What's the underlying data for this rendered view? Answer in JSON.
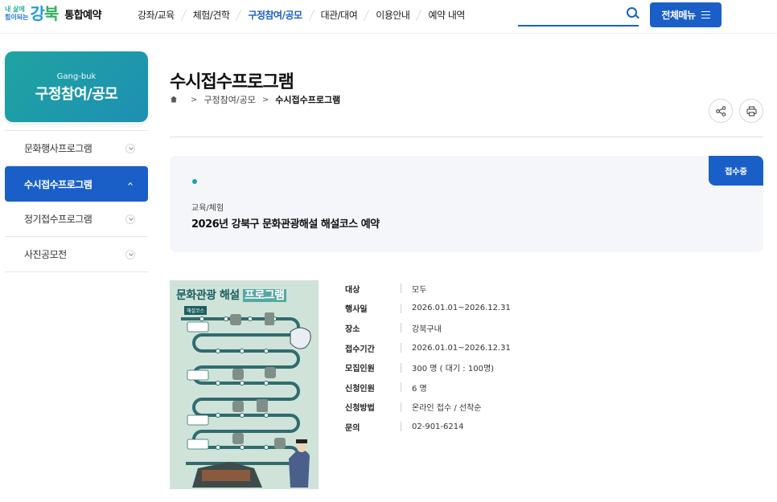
{
  "header": {
    "logo_small_line1": "내 삶에",
    "logo_small_line2": "힘이되는",
    "logo_big_part1": "강",
    "logo_big_part2": "북",
    "logo_name": "통합예약",
    "nav": [
      {
        "label": "강좌/교육"
      },
      {
        "label": "체험/견학"
      },
      {
        "label": "구정참여/공모"
      },
      {
        "label": "대관/대여"
      },
      {
        "label": "이용안내"
      },
      {
        "label": "예약 내역"
      }
    ],
    "active_nav": "구정참여/공모",
    "search_placeholder": "",
    "menu_label": "전체메뉴"
  },
  "sidebar": {
    "banner_en": "Gang-buk",
    "banner_ko": "구정참여/공모",
    "items": [
      {
        "label": "문화행사프로그램"
      },
      {
        "label": "수시접수프로그램"
      },
      {
        "label": "정기접수프로그램"
      },
      {
        "label": "사진공모전"
      }
    ],
    "active_item": "수시접수프로그램"
  },
  "main": {
    "title": "수시접수프로그램",
    "breadcrumb": [
      "구정참여/공모",
      "수시접수프로그램"
    ],
    "status": "접수중",
    "category": "교육/체험",
    "program_title": "2026년 강북구 문화관광해설 해설코스 예약",
    "poster_title_a": "문화관광 해설",
    "poster_title_b": "프로그램",
    "poster_sub": "해설코스",
    "details": [
      {
        "label": "대상",
        "value": "모두"
      },
      {
        "label": "행사일",
        "value": "2026.01.01~2026.12.31"
      },
      {
        "label": "장소",
        "value": "강북구내"
      },
      {
        "label": "접수기간",
        "value": "2026.01.01~2026.12.31"
      },
      {
        "label": "모집인원",
        "value": "300 명 ( 대기 : 100명)"
      },
      {
        "label": "신청인원",
        "value": "6 명"
      },
      {
        "label": "신청방법",
        "value": "온라인 접수 / 선착순"
      },
      {
        "label": "문의",
        "value": "02-901-6214"
      }
    ]
  },
  "colors": {
    "primary": "#1a5fc7",
    "teal": "#1fa4a0",
    "box_bg": "#f5f6f9"
  }
}
